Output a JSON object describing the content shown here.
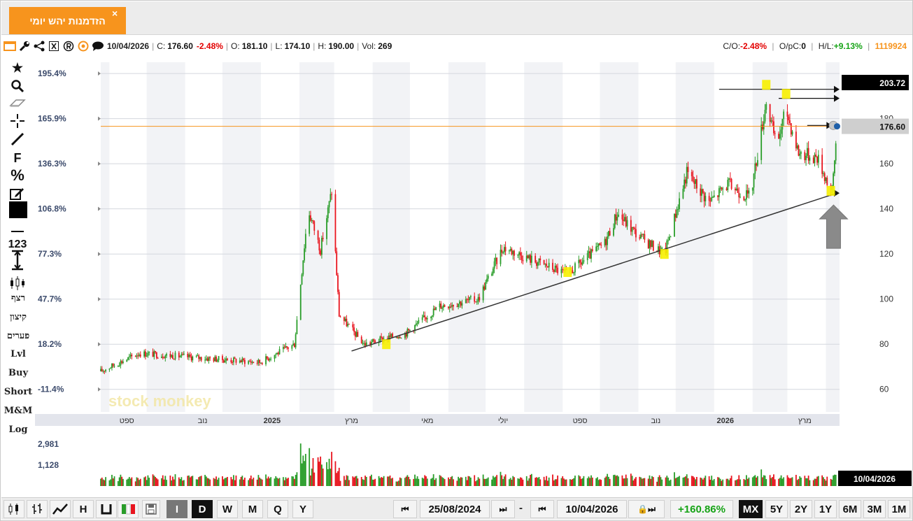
{
  "tab": {
    "title": "הזדמנות יהש יומי",
    "close": "×"
  },
  "info": {
    "date": "10/04/2026",
    "close_label": "C:",
    "close_value": "176.60",
    "change": "-2.48%",
    "open_label": "O:",
    "open_value": "181.10",
    "low_label": "L:",
    "low_value": "174.10",
    "high_label": "H:",
    "high_value": "190.00",
    "vol_label": "Vol:",
    "vol_value": "269",
    "co_label": "C/O:",
    "co_value": "-2.48%",
    "opc_label": "O/pC:",
    "opc_value": "0",
    "hl_label": "H/L:",
    "hl_value": "+9.13%",
    "code": "1119924"
  },
  "left_tools": {
    "f": "F",
    "percent": "%",
    "num": "123",
    "rezef": "רצף",
    "kitzun": "קיצון",
    "pearim": "פערים",
    "lvl": "Lvl",
    "buy": "Buy",
    "short": "Short",
    "mm": "M&M",
    "log": "Log"
  },
  "watermark": "stock monkey",
  "colors": {
    "up": "#2a9d2a",
    "down": "#e8141e",
    "accent": "#f7941d",
    "highlight": "#f7f000"
  },
  "chart_data": {
    "type": "candlestick",
    "title": "",
    "x_labels": [
      "ספט",
      "נוב",
      "2025",
      "מרץ",
      "מאי",
      "יולי",
      "ספט",
      "נוב",
      "2026",
      "מרץ"
    ],
    "y_left_ticks": [
      "195.4%",
      "165.9%",
      "136.3%",
      "106.8%",
      "77.3%",
      "47.7%",
      "18.2%",
      "-11.4%"
    ],
    "y_right_ticks": [
      "180",
      "160",
      "140",
      "120",
      "100",
      "80",
      "60"
    ],
    "ylim": [
      50,
      205
    ],
    "last_price": "176.60",
    "top_marker": "203.72",
    "date_range": [
      "25/08/2024",
      "10/04/2026"
    ],
    "volume_ticks": [
      "2,981",
      "1,128"
    ],
    "volume_date": "10/04/2026",
    "key_points": [
      {
        "date": "2024-08-25",
        "price": 68
      },
      {
        "date": "2024-09-25",
        "price": 76
      },
      {
        "date": "2024-12-31",
        "price": 72
      },
      {
        "date": "2025-01-28",
        "price": 80
      },
      {
        "date": "2025-02-08",
        "price": 140
      },
      {
        "date": "2025-02-18",
        "price": 122
      },
      {
        "date": "2025-02-27",
        "price": 148
      },
      {
        "date": "2025-03-05",
        "price": 93
      },
      {
        "date": "2025-03-25",
        "price": 80
      },
      {
        "date": "2025-04-28",
        "price": 85
      },
      {
        "date": "2025-05-25",
        "price": 97
      },
      {
        "date": "2025-06-25",
        "price": 100
      },
      {
        "date": "2025-07-15",
        "price": 123
      },
      {
        "date": "2025-08-05",
        "price": 118
      },
      {
        "date": "2025-09-05",
        "price": 111
      },
      {
        "date": "2025-10-05",
        "price": 125
      },
      {
        "date": "2025-10-15",
        "price": 138
      },
      {
        "date": "2025-11-01",
        "price": 128
      },
      {
        "date": "2025-11-22",
        "price": 120
      },
      {
        "date": "2025-12-10",
        "price": 156
      },
      {
        "date": "2025-12-28",
        "price": 143
      },
      {
        "date": "2026-01-12",
        "price": 151
      },
      {
        "date": "2026-01-30",
        "price": 145
      },
      {
        "date": "2026-02-12",
        "price": 188
      },
      {
        "date": "2026-02-20",
        "price": 168
      },
      {
        "date": "2026-02-28",
        "price": 184
      },
      {
        "date": "2026-03-10",
        "price": 165
      },
      {
        "date": "2026-03-25",
        "price": 163
      },
      {
        "date": "2026-04-06",
        "price": 147
      },
      {
        "date": "2026-04-10",
        "price": 176.6
      }
    ],
    "trendline": [
      {
        "date": "2025-03-15",
        "price": 77
      },
      {
        "date": "2026-04-10",
        "price": 147
      }
    ],
    "arrows": [
      {
        "from": "2026-01-05",
        "to": "2026-04-12",
        "price": 193
      },
      {
        "from": "2026-02-22",
        "to": "2026-04-12",
        "price": 189
      },
      {
        "from": "2026-03-17",
        "to": "2026-04-06",
        "price": 177
      },
      {
        "from": "2026-04-10",
        "to": "2026-04-12",
        "price": 147
      }
    ],
    "highlight_points": [
      {
        "date": "2025-04-12",
        "price": 80
      },
      {
        "date": "2025-09-05",
        "price": 112
      },
      {
        "date": "2025-11-22",
        "price": 120
      },
      {
        "date": "2026-02-12",
        "price": 195
      },
      {
        "date": "2026-02-28",
        "price": 191
      },
      {
        "date": "2026-04-05",
        "price": 148
      }
    ],
    "grid": true,
    "legend": "none"
  },
  "bottom": {
    "btn_i": "I",
    "btn_d": "D",
    "btn_w": "W",
    "btn_m": "M",
    "btn_q": "Q",
    "btn_y": "Y",
    "start_date": "25/08/2024",
    "end_date": "10/04/2026",
    "range_change": "+160.86%",
    "ranges": [
      "MX",
      "5Y",
      "2Y",
      "1Y",
      "6M",
      "3M",
      "1M"
    ],
    "dash": "-"
  }
}
